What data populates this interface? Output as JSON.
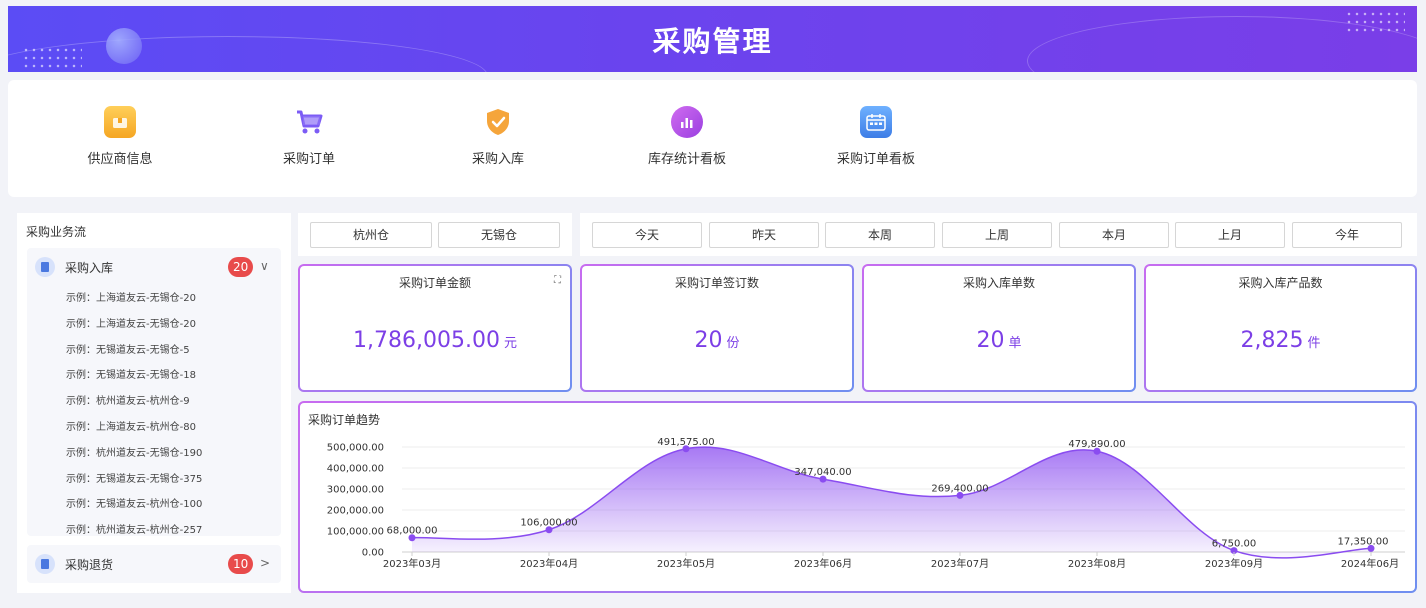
{
  "header": {
    "title": "采购管理"
  },
  "nav": {
    "items": [
      {
        "label": "供应商信息",
        "icon": "supplier-icon",
        "color": "#f7b733"
      },
      {
        "label": "采购订单",
        "icon": "cart-icon",
        "color": "#7c5cf5"
      },
      {
        "label": "采购入库",
        "icon": "shield-check-icon",
        "color": "#f5a53b"
      },
      {
        "label": "库存统计看板",
        "icon": "bar-chart-icon",
        "color": "#b94ce8"
      },
      {
        "label": "采购订单看板",
        "icon": "calendar-icon",
        "color": "#4a8ef2"
      }
    ]
  },
  "sidebar": {
    "title": "采购业务流",
    "groups": [
      {
        "label": "采购入库",
        "badge": "20",
        "expanded": true,
        "items": [
          "示例：上海道友云-无锡仓-20",
          "示例：上海道友云-无锡仓-20",
          "示例：无锡道友云-无锡仓-5",
          "示例：无锡道友云-无锡仓-18",
          "示例：杭州道友云-杭州仓-9",
          "示例：上海道友云-杭州仓-80",
          "示例：杭州道友云-无锡仓-190",
          "示例：无锡道友云-无锡仓-375",
          "示例：无锡道友云-杭州仓-100",
          "示例：杭州道友云-杭州仓-257"
        ]
      },
      {
        "label": "采购退货",
        "badge": "10",
        "expanded": false,
        "items": []
      }
    ]
  },
  "warehouses": [
    "杭州仓",
    "无锡仓"
  ],
  "periods": [
    "今天",
    "昨天",
    "本周",
    "上周",
    "本月",
    "上月",
    "今年"
  ],
  "stats": [
    {
      "title": "采购订单金额",
      "value": "1,786,005.00",
      "unit": "元"
    },
    {
      "title": "采购订单签订数",
      "value": "20",
      "unit": "份"
    },
    {
      "title": "采购入库单数",
      "value": "20",
      "unit": "单"
    },
    {
      "title": "采购入库产品数",
      "value": "2,825",
      "unit": "件"
    }
  ],
  "chart_title": "采购订单趋势",
  "colors": {
    "accent": "#7c3fe6",
    "badge": "#e84b4b",
    "banner_start": "#5b4cf5",
    "banner_end": "#7a3ee8"
  },
  "chart_data": {
    "type": "area",
    "title": "采购订单趋势",
    "categories": [
      "2023年03月",
      "2023年04月",
      "2023年05月",
      "2023年06月",
      "2023年07月",
      "2023年08月",
      "2023年09月",
      "2024年06月"
    ],
    "values": [
      68000,
      106000,
      491575,
      347040,
      269400,
      479890,
      6750,
      17350
    ],
    "data_labels": [
      "68,000.00",
      "106,000.00",
      "491,575.00",
      "347,040.00",
      "269,400.00",
      "479,890.00",
      "6,750.00",
      "17,350.00"
    ],
    "y_ticks": [
      "0.00",
      "100,000.00",
      "200,000.00",
      "300,000.00",
      "400,000.00",
      "500,000.00"
    ],
    "ylim": [
      0,
      500000
    ],
    "grid": true,
    "smooth": true
  }
}
